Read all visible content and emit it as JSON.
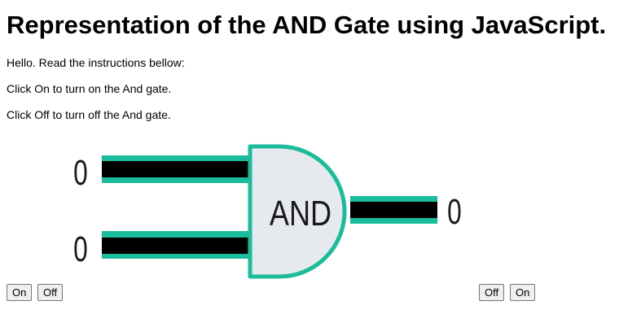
{
  "page": {
    "heading": "Representation of the AND Gate using JavaScript.",
    "paragraphs": [
      "Hello. Read the instructions bellow:",
      "Click On to turn on the And gate.",
      "Click Off to turn off the And gate."
    ]
  },
  "gate": {
    "label": "AND",
    "input_a": "0",
    "input_b": "0",
    "output": "0",
    "colors": {
      "wire": "#000000",
      "wire_edge": "#1abc9c",
      "body_fill": "#e6e9ed",
      "body_stroke": "#1abc9c"
    }
  },
  "controls": {
    "input_a": {
      "on_label": "On",
      "off_label": "Off"
    },
    "input_b": {
      "off_label": "Off",
      "on_label": "On"
    }
  }
}
